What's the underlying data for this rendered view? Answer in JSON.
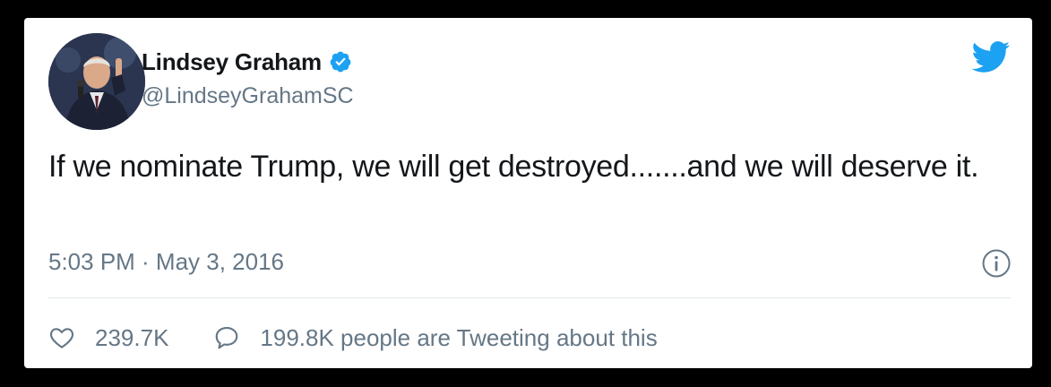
{
  "tweet": {
    "author": {
      "name": "Lindsey Graham",
      "handle": "@LindseyGrahamSC",
      "verified": true
    },
    "text": "If we nominate Trump, we will get destroyed.......and we will deserve it.",
    "timestamp": "5:03 PM · May 3, 2016",
    "stats": {
      "likes": "239.7K",
      "tweeting": "199.8K people are Tweeting about this"
    }
  },
  "icons": {
    "brand": "twitter-bird-icon",
    "verified": "verified-badge-icon",
    "info": "info-icon",
    "like": "heart-icon",
    "reply": "speech-bubble-icon"
  },
  "colors": {
    "brand_blue": "#1da1f2",
    "text": "#14171a",
    "secondary_text": "#657786",
    "divider": "#e1e8ed",
    "background_frame": "#000000",
    "card": "#ffffff"
  }
}
